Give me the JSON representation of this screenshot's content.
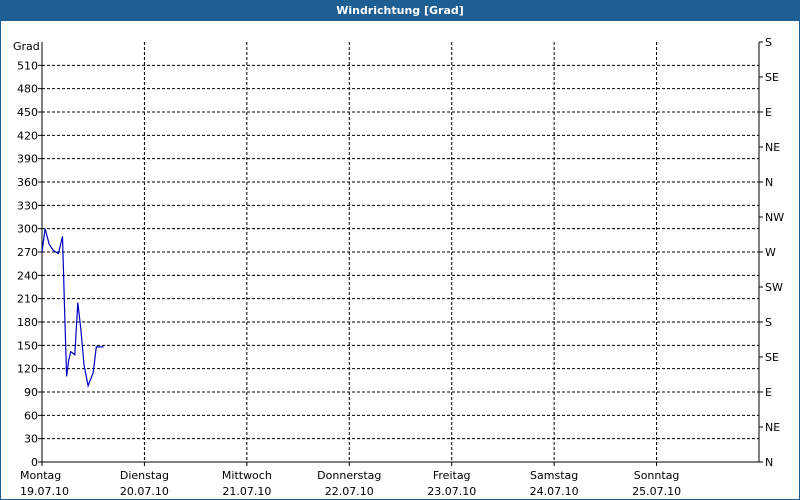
{
  "window": {
    "title": "Windrichtung [Grad]"
  },
  "chart_data": {
    "type": "line",
    "title": "Windrichtung [Grad]",
    "ylabel": "Grad",
    "xlabel": "",
    "ylim": [
      0,
      540
    ],
    "xlim": [
      0,
      7
    ],
    "grid": true,
    "y_ticks": [
      0,
      30,
      60,
      90,
      120,
      150,
      180,
      210,
      240,
      270,
      300,
      330,
      360,
      390,
      420,
      450,
      480,
      510
    ],
    "right_ticks": [
      {
        "value": 0,
        "label": "N"
      },
      {
        "value": 45,
        "label": "NE"
      },
      {
        "value": 90,
        "label": "E"
      },
      {
        "value": 135,
        "label": "SE"
      },
      {
        "value": 180,
        "label": "S"
      },
      {
        "value": 225,
        "label": "SW"
      },
      {
        "value": 270,
        "label": "W"
      },
      {
        "value": 315,
        "label": "NW"
      },
      {
        "value": 360,
        "label": "N"
      },
      {
        "value": 405,
        "label": "NE"
      },
      {
        "value": 450,
        "label": "E"
      },
      {
        "value": 495,
        "label": "SE"
      },
      {
        "value": 540,
        "label": "S"
      }
    ],
    "x_ticks": [
      {
        "day": "Montag",
        "date": "19.07.10"
      },
      {
        "day": "Dienstag",
        "date": "20.07.10"
      },
      {
        "day": "Mittwoch",
        "date": "21.07.10"
      },
      {
        "day": "Donnerstag",
        "date": "22.07.10"
      },
      {
        "day": "Freitag",
        "date": "23.07.10"
      },
      {
        "day": "Samstag",
        "date": "24.07.10"
      },
      {
        "day": "Sonntag",
        "date": "25.07.10"
      }
    ],
    "series": [
      {
        "color": "#0000c0",
        "x": [
          0.0,
          0.03,
          0.07,
          0.11,
          0.16,
          0.2,
          0.22,
          0.24,
          0.26,
          0.28,
          0.3,
          0.32,
          0.35,
          0.38,
          0.41,
          0.45,
          0.5,
          0.53,
          0.55,
          0.58,
          0.6
        ],
        "y": [
          270,
          300,
          280,
          272,
          268,
          290,
          200,
          110,
          130,
          142,
          140,
          138,
          205,
          170,
          125,
          98,
          115,
          148,
          148,
          148,
          148
        ]
      }
    ]
  }
}
